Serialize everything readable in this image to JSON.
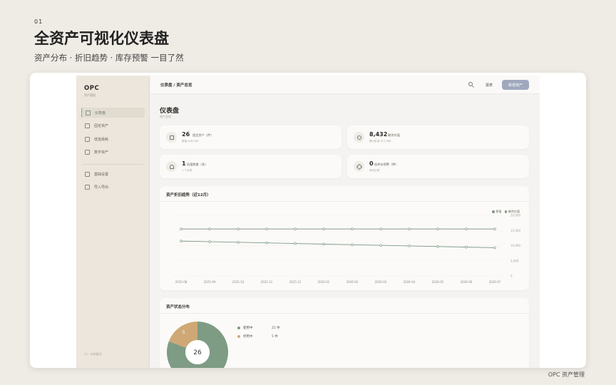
{
  "slide": {
    "number": "01",
    "title": "全资产可视化仪表盘",
    "subtitle": "资产分布 · 折旧趋势 · 库存预警 一目了然",
    "footer": "OPC 资产管理"
  },
  "app": {
    "brand": "OPC",
    "brand_sub": "资产管理",
    "nav": [
      {
        "label": "仪表盘",
        "icon": "dashboard-icon",
        "active": true
      },
      {
        "label": "固定资产",
        "icon": "cube-icon"
      },
      {
        "label": "低值易耗",
        "icon": "box-icon"
      },
      {
        "label": "数字资产",
        "icon": "monitor-icon"
      },
      {
        "label": "基础设置",
        "icon": "settings-icon"
      },
      {
        "label": "导入导出",
        "icon": "import-export-icon"
      }
    ],
    "sidebar_footer": "v1 · 本地模式",
    "topbar": {
      "breadcrumb": "仪表盘 / 资产总览",
      "link": "报表",
      "primary_button": "新增资产"
    },
    "page": {
      "title": "仪表盘",
      "subtitle": "资产总览"
    },
    "stats": [
      {
        "value": "26",
        "label": "固定资产（件）",
        "sub": "原值 ¥26,000",
        "icon": "cube-icon"
      },
      {
        "value": "8,432",
        "label": "剩余价值",
        "sub": "累计折旧 ¥17,568",
        "icon": "coin-icon"
      },
      {
        "value": "1",
        "label": "低值数量（条）",
        "sub": "1 个分类",
        "icon": "bulb-icon"
      },
      {
        "value": "0",
        "label": "低库存预警（种）",
        "sub": "库存正常",
        "icon": "warning-icon"
      }
    ],
    "depreciation": {
      "title": "资产折旧趋势（近12月）",
      "legend": [
        {
          "label": "原值",
          "color": "#8a9591"
        },
        {
          "label": "剩余价值",
          "color": "#7e9b88"
        }
      ]
    },
    "status": {
      "title": "资产状态分布",
      "total": "26",
      "items": [
        {
          "label": "使用中",
          "count": "21 件",
          "value": 21,
          "color": "#7e9b84"
        },
        {
          "label": "停用中",
          "count": "5 件",
          "value": 5,
          "color": "#cfa876"
        }
      ],
      "slice_label": "5"
    }
  },
  "chart_data": {
    "type": "line",
    "title": "资产折旧趋势（近12月）",
    "x": [
      "2025-08",
      "2025-09",
      "2025-10",
      "2025-11",
      "2025-12",
      "2026-01",
      "2026-02",
      "2026-03",
      "2026-04",
      "2026-05",
      "2026-06",
      "2026-07"
    ],
    "series": [
      {
        "name": "原值",
        "values": [
          15500,
          15500,
          15500,
          15500,
          15500,
          15500,
          15500,
          15500,
          15500,
          15500,
          15500,
          15500
        ],
        "color": "#8a9591"
      },
      {
        "name": "剩余价值",
        "values": [
          11500,
          11300,
          11100,
          10900,
          10700,
          10500,
          10300,
          10100,
          9900,
          9700,
          9500,
          9300
        ],
        "color": "#7e9b88"
      }
    ],
    "y_ticks": [
      "0",
      "5,000",
      "10,000",
      "15,000",
      "20,000"
    ],
    "ylim": [
      0,
      20000
    ],
    "grid": true,
    "legend_position": "top-right"
  }
}
